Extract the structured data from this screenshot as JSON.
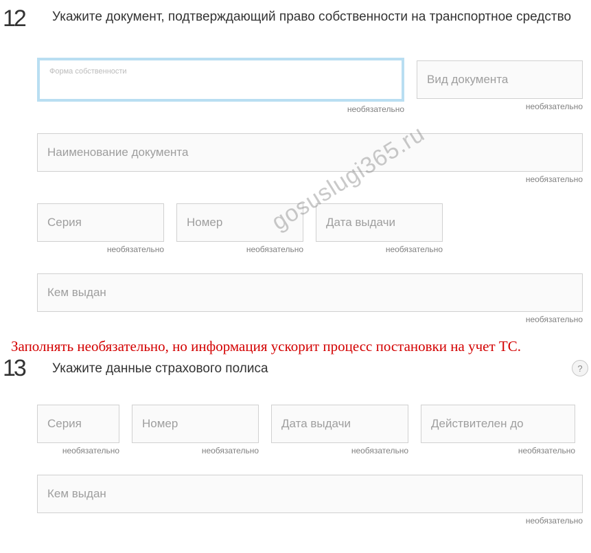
{
  "watermark": "gosuslugi365.ru",
  "section12": {
    "number": "12",
    "title": "Укажите документ, подтверждающий право собственности на транспортное средство",
    "fields": {
      "ownership_form": {
        "label": "Форма собственности",
        "optional": "необязательно"
      },
      "doc_type": {
        "placeholder": "Вид документа",
        "optional": "необязательно"
      },
      "doc_name": {
        "placeholder": "Наименование документа",
        "optional": "необязательно"
      },
      "series": {
        "placeholder": "Серия",
        "optional": "необязательно"
      },
      "number": {
        "placeholder": "Номер",
        "optional": "необязательно"
      },
      "issue_date": {
        "placeholder": "Дата выдачи",
        "optional": "необязательно"
      },
      "issued_by": {
        "placeholder": "Кем выдан",
        "optional": "необязательно"
      }
    }
  },
  "annotation": "Заполнять необязательно, но информация ускорит процесс постановки на учет ТС.",
  "section13": {
    "number": "13",
    "title": "Укажите данные страхового полиса",
    "help": "?",
    "fields": {
      "series": {
        "placeholder": "Серия",
        "optional": "необязательно"
      },
      "number": {
        "placeholder": "Номер",
        "optional": "необязательно"
      },
      "issue_date": {
        "placeholder": "Дата выдачи",
        "optional": "необязательно"
      },
      "valid_until": {
        "placeholder": "Действителен до",
        "optional": "необязательно"
      },
      "issued_by": {
        "placeholder": "Кем выдан",
        "optional": "необязательно"
      }
    }
  }
}
